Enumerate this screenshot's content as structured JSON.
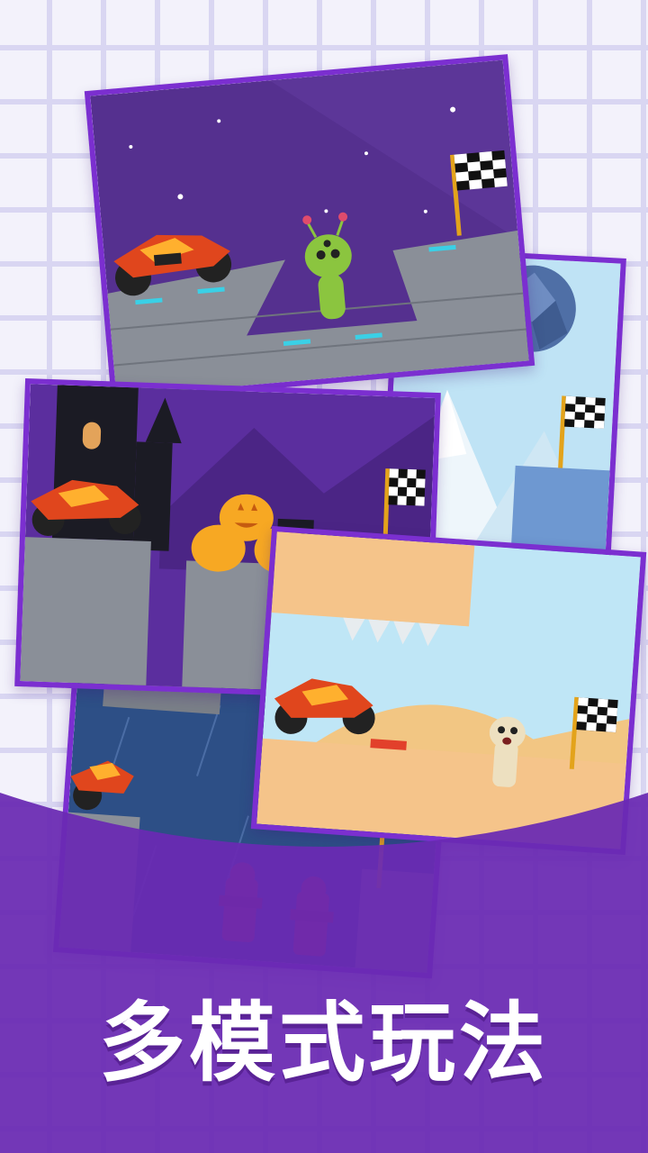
{
  "caption": "多模式玩法",
  "levels": [
    {
      "id": "space-level",
      "theme": "space",
      "obstacle": "alien",
      "goal": "checkered-flag"
    },
    {
      "id": "snow-level",
      "theme": "snow",
      "obstacle": "boulder",
      "goal": "checkered-flag"
    },
    {
      "id": "halloween-level",
      "theme": "halloween",
      "obstacle": "pumpkins",
      "goal": "checkered-flag"
    },
    {
      "id": "desert-level",
      "theme": "desert",
      "obstacle": "mummy",
      "goal": "checkered-flag"
    },
    {
      "id": "city-level",
      "theme": "rain-city",
      "obstacle": "fire-hydrants",
      "goal": "checkered-flag"
    }
  ],
  "colors": {
    "frame": "#7b2fd0",
    "band": "#6a2bb3",
    "caption_text": "#ffffff",
    "grid_line": "#d9d6f2"
  }
}
